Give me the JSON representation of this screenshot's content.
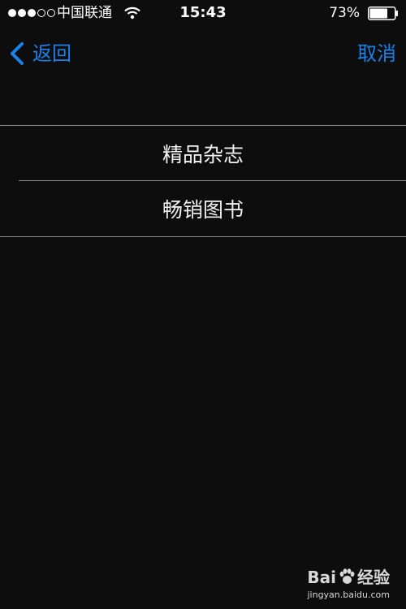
{
  "status_bar": {
    "signal_dots_filled": 3,
    "signal_dots_total": 5,
    "carrier": "中国联通",
    "time": "15:43",
    "battery_percent": "73%",
    "battery_level": 0.73
  },
  "nav": {
    "back_label": "返回",
    "cancel_label": "取消"
  },
  "list": {
    "items": [
      {
        "label": "精品杂志"
      },
      {
        "label": "畅销图书"
      }
    ]
  },
  "watermark": {
    "brand_left": "Bai",
    "brand_right": "经验",
    "url": "jingyan.baidu.com"
  },
  "colors": {
    "background": "#0d0d0d",
    "accent": "#1a82ea",
    "separator": "#8a8a8a",
    "text": "#f2f2f2"
  },
  "icons": {
    "back": "chevron-left-icon",
    "wifi": "wifi-icon",
    "battery": "battery-icon",
    "watermark": "paw-icon"
  }
}
